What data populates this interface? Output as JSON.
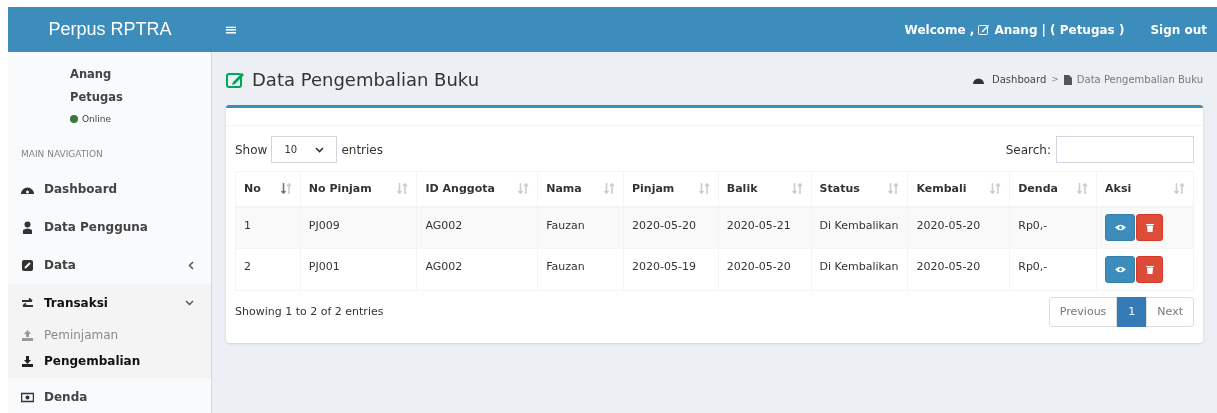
{
  "header": {
    "brand": "Perpus RPTRA",
    "menu_toggle": "≡",
    "welcome": "Welcome ,",
    "user": "Anang",
    "role": "| ( Petugas )",
    "sign_out": "Sign out"
  },
  "sidebar": {
    "user": {
      "name": "Anang",
      "role": "Petugas",
      "status": "Online"
    },
    "nav_header": "MAIN NAVIGATION",
    "items": [
      {
        "label": "Dashboard",
        "selected": false
      },
      {
        "label": "Data Pengguna",
        "selected": false
      },
      {
        "label": "Data",
        "selected": false,
        "expanded": false
      },
      {
        "label": "Transaksi",
        "selected": true,
        "expanded": true,
        "children": [
          {
            "label": "Peminjaman",
            "selected": false
          },
          {
            "label": "Pengembalian",
            "selected": true
          }
        ]
      },
      {
        "label": "Denda",
        "selected": false
      }
    ]
  },
  "page": {
    "title": "Data Pengembalian Buku",
    "breadcrumb": [
      "Dashboard",
      "Data Pengembalian Buku"
    ],
    "breadcrumb_separator": ">"
  },
  "table": {
    "length_label_before": "Show",
    "length_value": "10",
    "length_label_after": "entries",
    "search_label": "Search:",
    "columns": [
      {
        "label": "No",
        "sorted": true
      },
      {
        "label": "No Pinjam",
        "sorted": false
      },
      {
        "label": "ID Anggota",
        "sorted": false
      },
      {
        "label": "Nama",
        "sorted": false
      },
      {
        "label": "Pinjam",
        "sorted": false
      },
      {
        "label": "Balik",
        "sorted": false
      },
      {
        "label": "Status",
        "sorted": false
      },
      {
        "label": "Kembali",
        "sorted": false
      },
      {
        "label": "Denda",
        "sorted": false
      },
      {
        "label": "Aksi",
        "sorted": false
      }
    ],
    "rows": [
      [
        "1",
        "PJ009",
        "AG002",
        "Fauzan",
        "2020-05-20",
        "2020-05-21",
        "Di Kembalikan",
        "2020-05-20",
        "Rp0,-"
      ],
      [
        "2",
        "PJ001",
        "AG002",
        "Fauzan",
        "2020-05-19",
        "2020-05-20",
        "Di Kembalikan",
        "2020-05-20",
        "Rp0,-"
      ]
    ],
    "info": "Showing 1 to 2 of 2 entries",
    "pagination": [
      {
        "label": "Previous",
        "selected": false
      },
      {
        "label": "1",
        "selected": true
      },
      {
        "label": "Next",
        "selected": false
      }
    ]
  }
}
